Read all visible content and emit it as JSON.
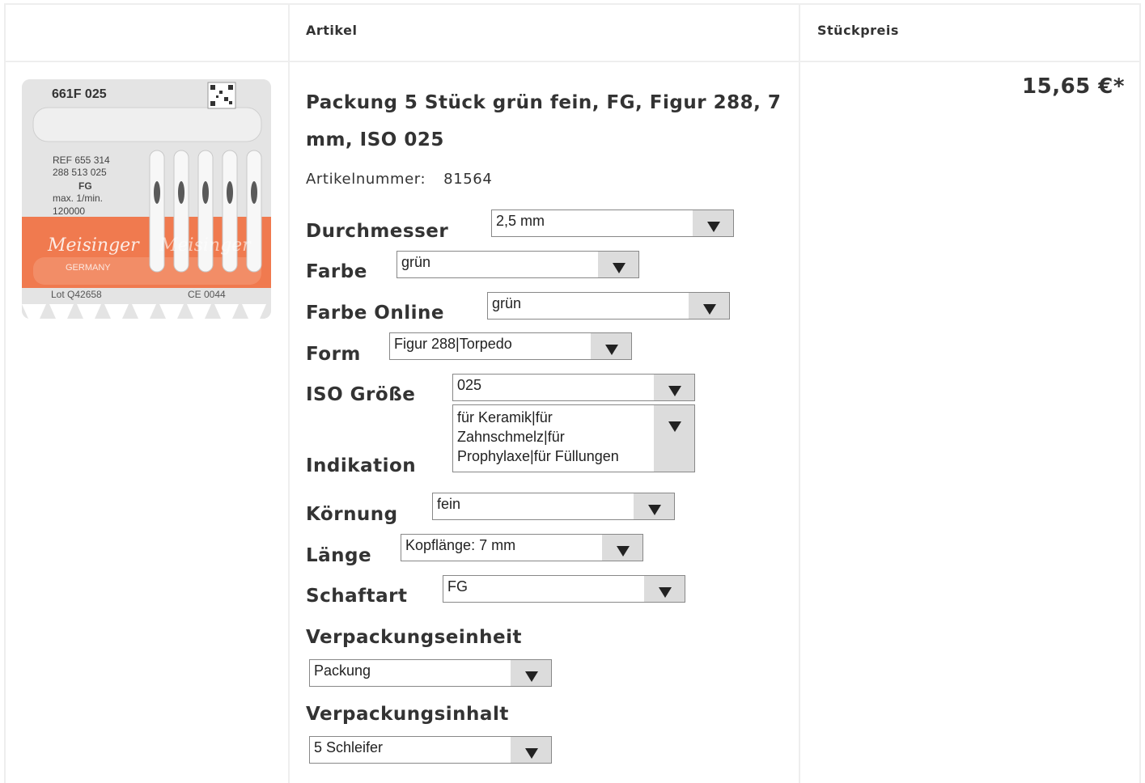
{
  "table": {
    "headers": {
      "empty": "",
      "article": "Artikel",
      "unit_price": "Stückpreis"
    }
  },
  "product": {
    "image": {
      "code_line": "661F   025",
      "ref_lines": [
        "REF 655 314",
        "288 513 025",
        "FG",
        "max. 1/min.",
        "120000"
      ],
      "brand": "Meisinger",
      "country": "GERMANY",
      "lot": "Lot  Q42658",
      "ce": "CE 0044"
    },
    "title": "Packung 5 Stück grün fein, FG, Figur 288, 7 mm, ISO 025",
    "article_number_label": "Artikelnummer:",
    "article_number": "81564",
    "price": "15,65 €*"
  },
  "options": [
    {
      "label": "Durchmesser",
      "value": "2,5 mm"
    },
    {
      "label": "Farbe",
      "value": "grün"
    },
    {
      "label": "Farbe Online",
      "value": "grün"
    },
    {
      "label": "Form",
      "value": "Figur 288|Torpedo"
    },
    {
      "label": "ISO Größe",
      "value": "025"
    },
    {
      "label": "Indikation",
      "value": "für Keramik|für Zahnschmelz|für Prophylaxe|für Füllungen"
    },
    {
      "label": "Körnung",
      "value": "fein"
    },
    {
      "label": "Länge",
      "value": "Kopflänge: 7 mm"
    },
    {
      "label": "Schaftart",
      "value": "FG"
    },
    {
      "label": "Verpackungseinheit",
      "value": "Packung"
    },
    {
      "label": "Verpackungsinhalt",
      "value": "5 Schleifer"
    }
  ],
  "icons": {
    "select_arrow": "triangle-down-icon"
  },
  "colors": {
    "grid_line": "#eeeeee",
    "select_button": "#dcdcdc",
    "packaging_orange": "#f07a4f"
  }
}
